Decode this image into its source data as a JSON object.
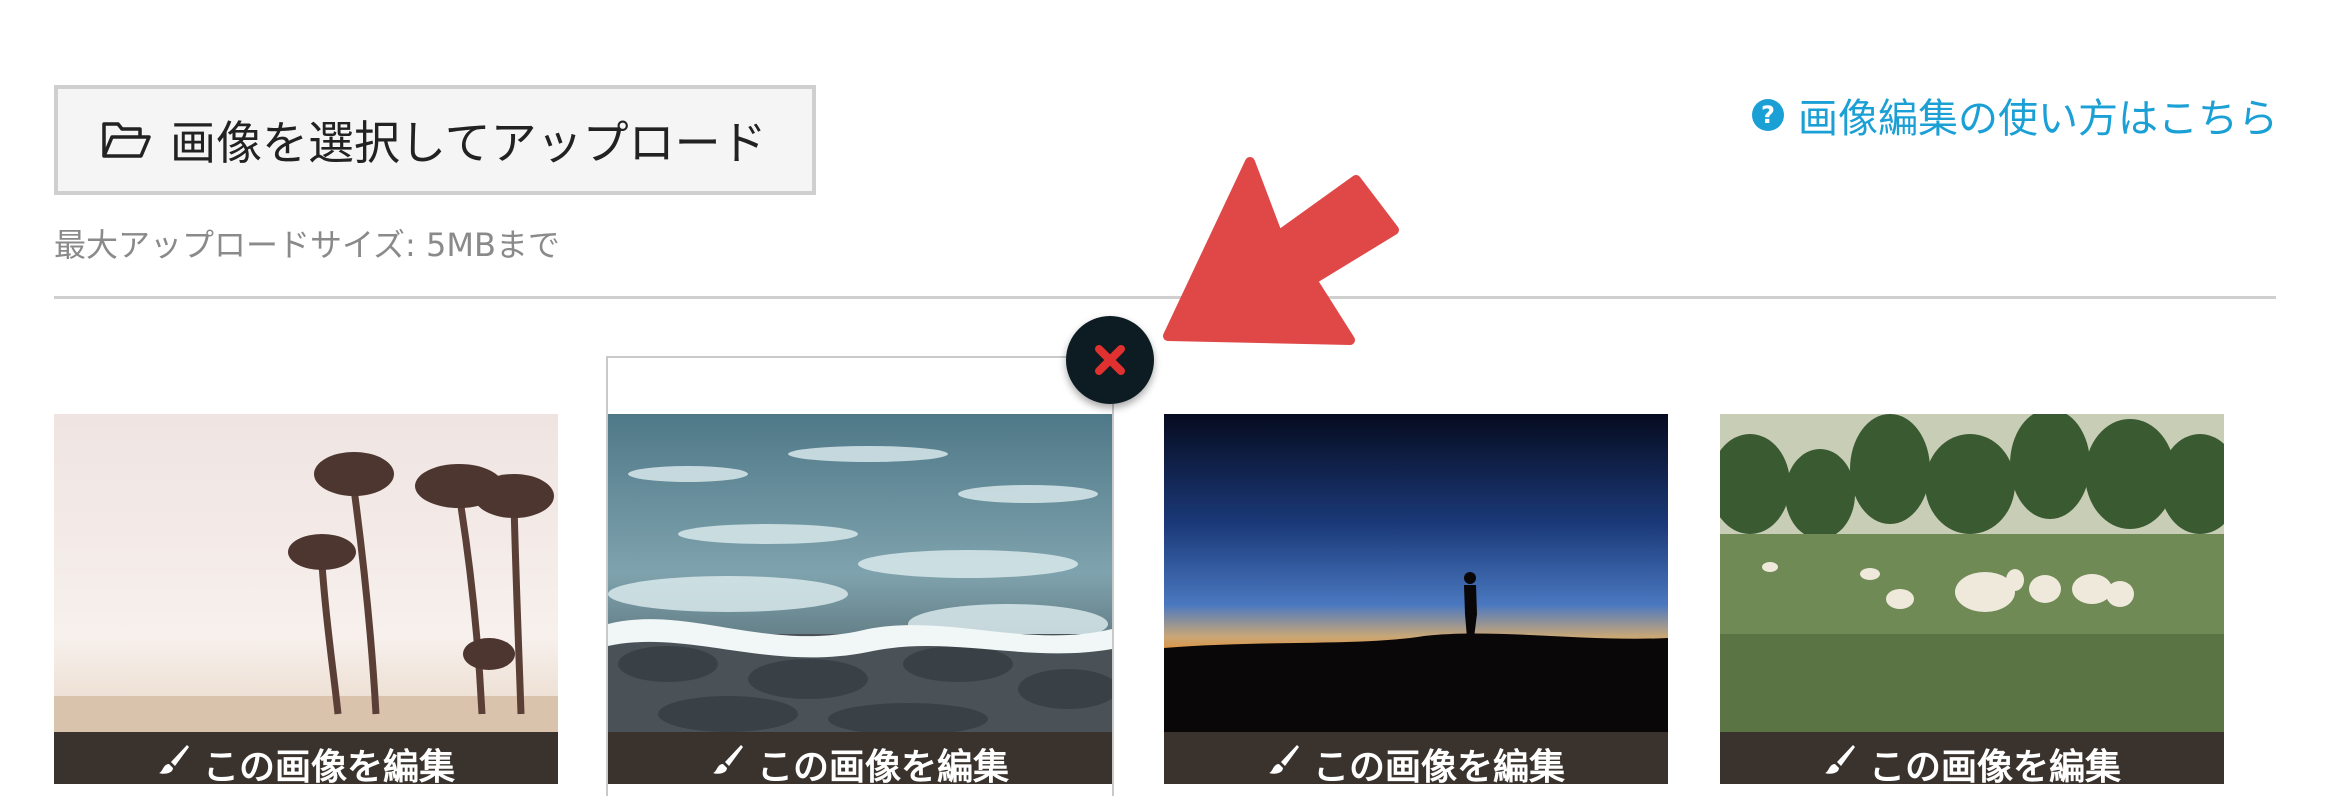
{
  "upload": {
    "button_label": "画像を選択してアップロード",
    "button_icon": "folder-open-icon",
    "size_note": "最大アップロードサイズ: 5MBまで"
  },
  "help": {
    "icon": "question-circle-icon",
    "link_label": "画像編集の使い方はこちら"
  },
  "gallery": {
    "selected_index": 1,
    "remove_icon": "close-icon",
    "images": [
      {
        "edit_label": "この画像を編集",
        "icon": "paintbrush-icon"
      },
      {
        "edit_label": "この画像を編集",
        "icon": "paintbrush-icon"
      },
      {
        "edit_label": "この画像を編集",
        "icon": "paintbrush-icon"
      },
      {
        "edit_label": "この画像を編集",
        "icon": "paintbrush-icon"
      }
    ]
  },
  "colors": {
    "accent": "#1ba0d6",
    "annotation_arrow": "#e04848",
    "edit_bar": "#3a322c",
    "remove_x": "#e03030"
  }
}
